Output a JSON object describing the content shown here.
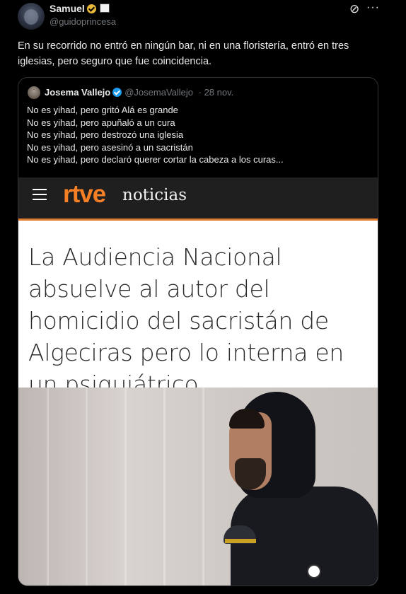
{
  "author": {
    "name": "Samuel",
    "handle": "@guidoprincesa"
  },
  "tweet": {
    "text": "En su recorrido no entró en ningún bar, ni en una floristería, entró en tres iglesias, pero seguro que fue coincidencia."
  },
  "quoted": {
    "name": "Josema Vallejo",
    "handle": "@JosemaVallejo",
    "date": "· 28 nov.",
    "lines": [
      "No es yihad, pero gritó Alá es grande",
      "No es yihad, pero apuñaló a un cura",
      "No es yihad, pero destrozó una iglesia",
      "No es yihad, pero asesinó a un sacristán",
      "No es yihad, pero declaró querer cortar la cabeza a los curas..."
    ]
  },
  "media": {
    "brand": "rtve",
    "section": "noticias",
    "headline": "La Audiencia Nacional absuelve al autor del homicidio del sacristán de Algeciras pero lo interna en un psiquiátrico"
  },
  "icons": {
    "grok": "grok-icon",
    "more": "more-icon",
    "menu": "hamburger-icon"
  },
  "colors": {
    "background": "#000000",
    "text": "#e7e9ea",
    "muted": "#71767b",
    "gold_badge": "#e8b839",
    "blue_badge": "#1d9bf0",
    "rtve_orange": "#f57f25"
  }
}
